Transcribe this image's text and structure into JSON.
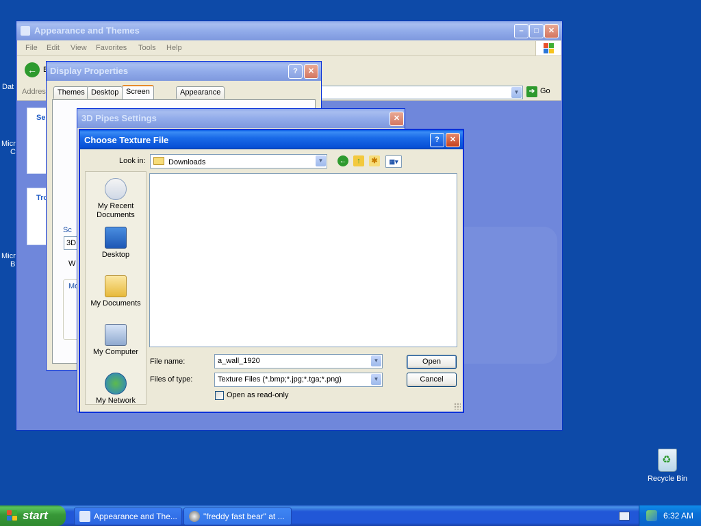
{
  "desktop": {
    "fragments": [
      "Dat",
      "Micr",
      "C",
      "Micr",
      "B"
    ],
    "recycle_bin_label": "Recycle Bin"
  },
  "explorer": {
    "title": "Appearance and Themes",
    "menu": [
      "File",
      "Edit",
      "View",
      "Favorites",
      "Tools",
      "Help"
    ],
    "back_label": "B",
    "address_label": "Address",
    "go_label": "Go",
    "side_panel_fragments": [
      "Se",
      "Tro"
    ]
  },
  "display_properties": {
    "title": "Display Properties",
    "tabs": [
      "Themes",
      "Desktop",
      "Screen Saver",
      "Appearance"
    ],
    "active_tab": "Screen Saver",
    "fragments": [
      "Sc",
      "3D",
      "W",
      "Mo"
    ]
  },
  "pipes_settings": {
    "title": "3D Pipes Settings"
  },
  "texture_dialog": {
    "title": "Choose Texture File",
    "look_in_label": "Look in:",
    "look_in_value": "Downloads",
    "places": [
      "My Recent Documents",
      "Desktop",
      "My Documents",
      "My Computer",
      "My Network"
    ],
    "file_name_label": "File name:",
    "file_name_value": "a_wall_1920",
    "files_of_type_label": "Files of type:",
    "files_of_type_value": "Texture Files (*.bmp;*.jpg;*.tga;*.png)",
    "read_only_label": "Open as read-only",
    "open_label": "Open",
    "cancel_label": "Cancel"
  },
  "taskbar": {
    "start_label": "start",
    "tasks": [
      "Appearance and The...",
      "\"freddy fast bear\" at ..."
    ],
    "clock": "6:32 AM"
  },
  "colors": {
    "desktop": "#0d4aa8",
    "title_active": "#0750d6",
    "taskbar": "#2157d7",
    "start": "#389838"
  }
}
